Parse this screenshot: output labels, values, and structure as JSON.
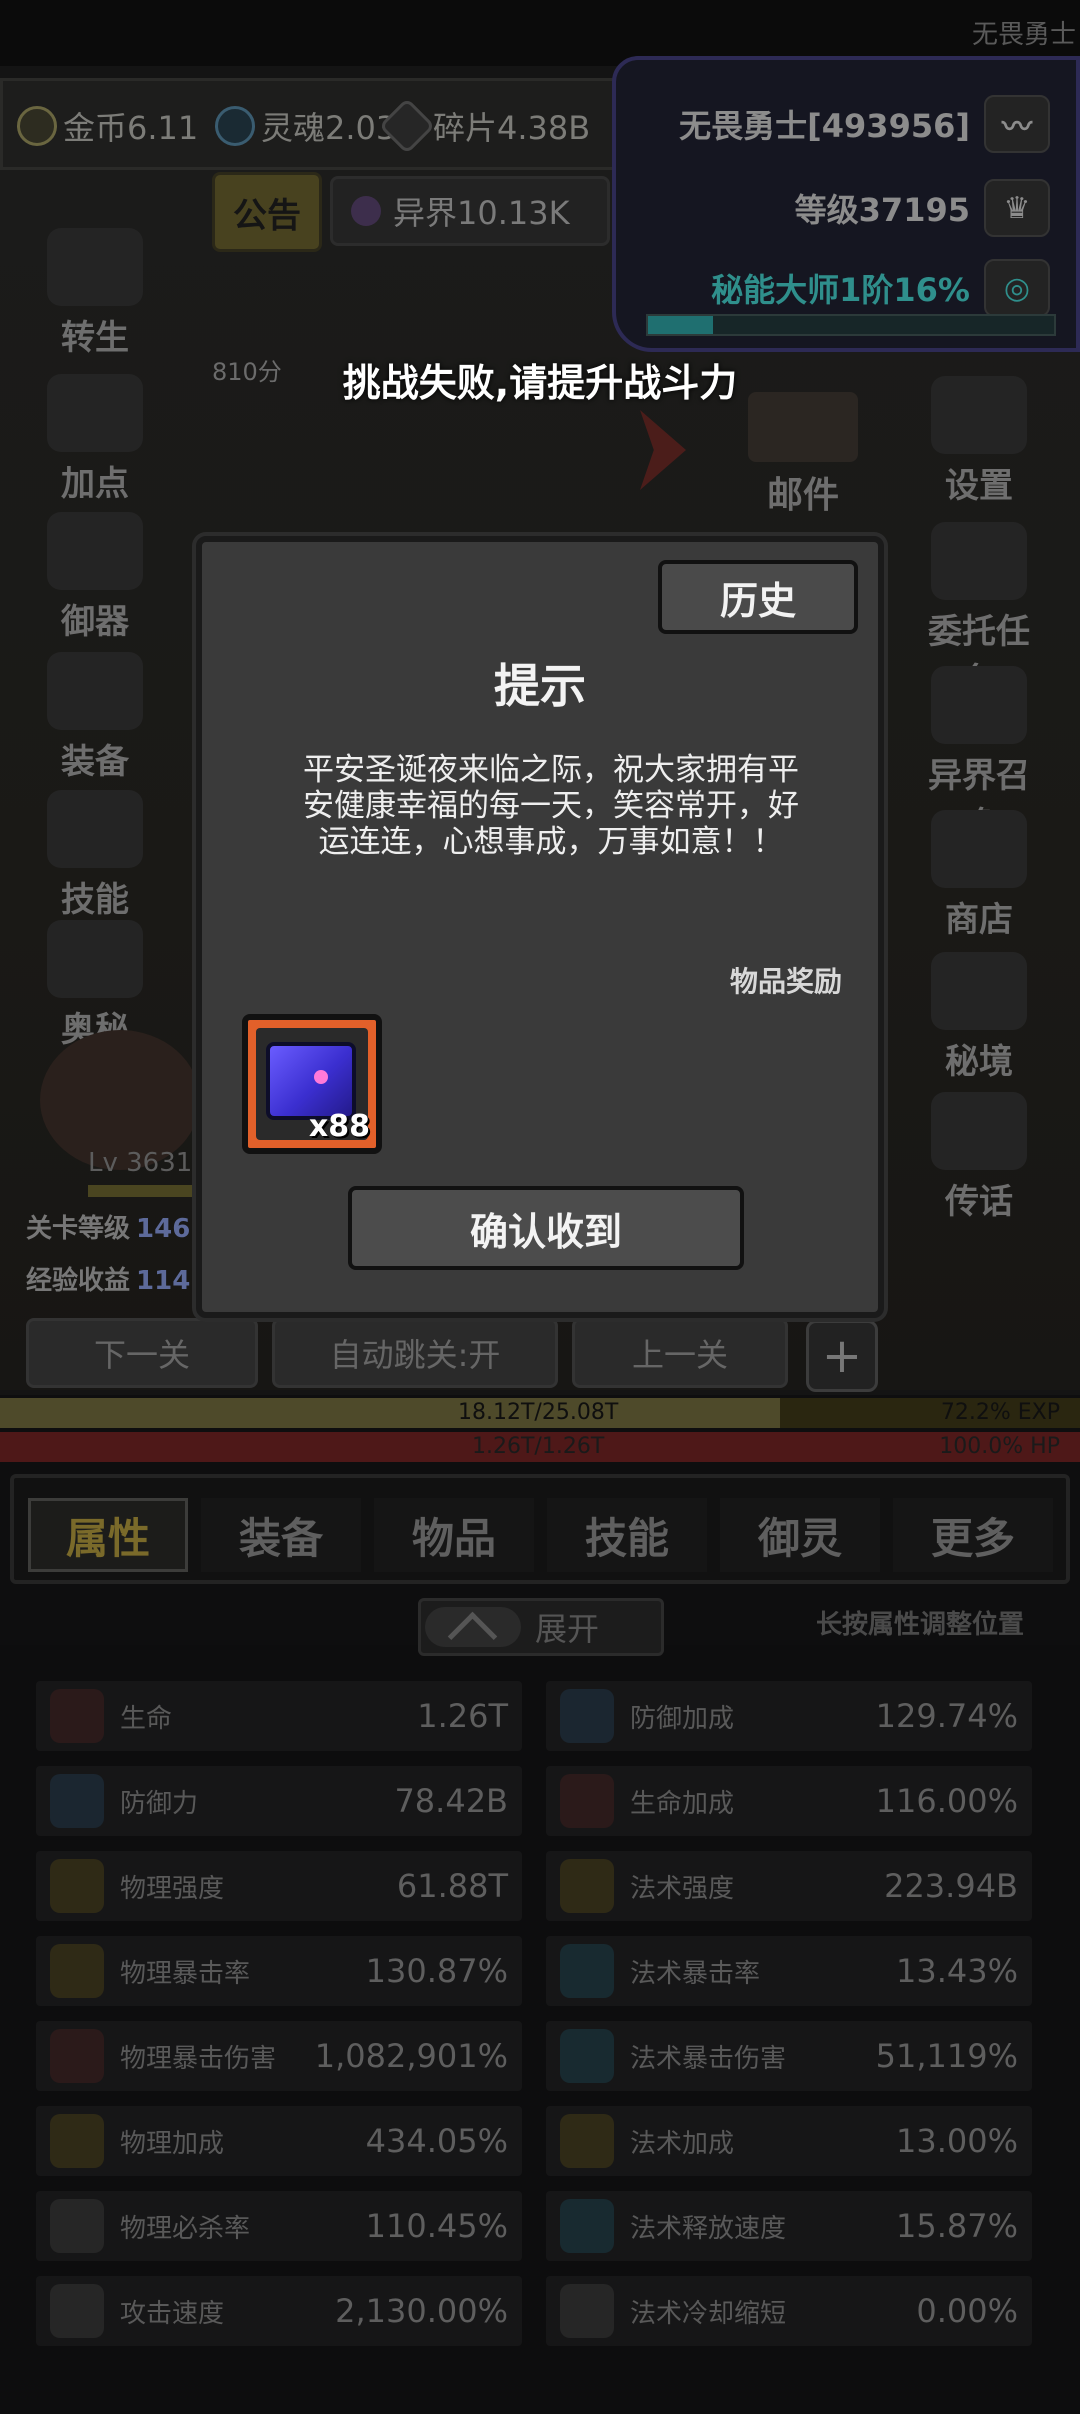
{
  "top_right_label": "无畏勇士",
  "resources": {
    "gold": "金币6.11",
    "soul": "灵魂2.03",
    "fragment": "碎片4.38B"
  },
  "notice_label": "公告",
  "otherworld_label": "异界10.13K",
  "player": {
    "name": "无畏勇士[493956]",
    "level": "等级37195",
    "mystic": "秘能大师1阶16%",
    "mystic_progress": 0.16
  },
  "score_text": "810分",
  "toast": "挑战失败,请提升战斗力",
  "left_menu": [
    "转生",
    "加点",
    "御器",
    "装备",
    "技能",
    "奥秘"
  ],
  "right_menu": [
    "设置",
    "委托任务",
    "异界召唤",
    "商店",
    "秘境",
    "传话"
  ],
  "mail_label": "邮件",
  "hero_level": "Lv 3631",
  "stage": {
    "level_label": "关卡等级",
    "level_value": "146",
    "exp_label": "经验收益",
    "exp_value": "114"
  },
  "nav": {
    "next": "下一关",
    "auto": "自动跳关:开",
    "prev": "上一关",
    "plus": "+"
  },
  "exp_bar": {
    "text": "18.12T/25.08T",
    "percent": "72.2% EXP",
    "fill": 0.722
  },
  "hp_bar": {
    "text": "1.26T/1.26T",
    "percent": "100.0% HP",
    "fill": 1.0
  },
  "tabs": [
    "属性",
    "装备",
    "物品",
    "技能",
    "御灵",
    "更多"
  ],
  "expand_label": "展开",
  "long_press_hint": "长按属性调整位置",
  "stats": [
    {
      "label": "生命",
      "value": "1.26T",
      "icon": "heart-icon",
      "tone": ""
    },
    {
      "label": "防御加成",
      "value": "129.74%",
      "icon": "shield-plus-icon",
      "tone": "b"
    },
    {
      "label": "防御力",
      "value": "78.42B",
      "icon": "shield-icon",
      "tone": "b"
    },
    {
      "label": "生命加成",
      "value": "116.00%",
      "icon": "heart-plus-icon",
      "tone": ""
    },
    {
      "label": "物理强度",
      "value": "61.88T",
      "icon": "sword-icon",
      "tone": "y"
    },
    {
      "label": "法术强度",
      "value": "223.94B",
      "icon": "magic-icon",
      "tone": "y"
    },
    {
      "label": "物理暴击率",
      "value": "130.87%",
      "icon": "crit-icon",
      "tone": "y"
    },
    {
      "label": "法术暴击率",
      "value": "13.43%",
      "icon": "magic-crit-icon",
      "tone": "c"
    },
    {
      "label": "物理暴击伤害",
      "value": "1,082,901%",
      "icon": "crit-damage-icon",
      "tone": ""
    },
    {
      "label": "法术暴击伤害",
      "value": "51,119%",
      "icon": "magic-crit-damage-icon",
      "tone": "c"
    },
    {
      "label": "物理加成",
      "value": "434.05%",
      "icon": "physical-bonus-icon",
      "tone": "y"
    },
    {
      "label": "法术加成",
      "value": "13.00%",
      "icon": "magic-bonus-icon",
      "tone": "y"
    },
    {
      "label": "物理必杀率",
      "value": "110.45%",
      "icon": "skull-icon",
      "tone": "g"
    },
    {
      "label": "法术释放速度",
      "value": "15.87%",
      "icon": "cast-speed-icon",
      "tone": "c"
    },
    {
      "label": "攻击速度",
      "value": "2,130.00%",
      "icon": "attack-speed-icon",
      "tone": "g"
    },
    {
      "label": "法术冷却缩短",
      "value": "0.00%",
      "icon": "hourglass-icon",
      "tone": "g"
    }
  ],
  "dialog": {
    "history": "历史",
    "title": "提示",
    "message": "平安圣诞夜来临之际，祝大家拥有平安健康幸福的每一天，笑容常开，好运连连，心想事成，万事如意！！",
    "reward_label": "物品奖励",
    "reward_qty": "x88",
    "confirm": "确认收到"
  }
}
